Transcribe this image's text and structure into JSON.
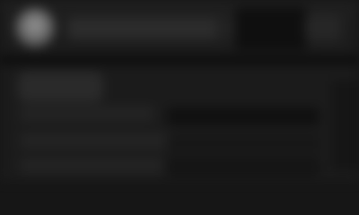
{
  "screen": {
    "accent_colors": {
      "background": "#1a1a1a",
      "avatar": "#8a8a8a",
      "dark_region": "#0f0f0f"
    }
  },
  "header": {
    "avatar_icon": "user-avatar-icon",
    "title": "",
    "action_icon": "menu-icon"
  },
  "form": {
    "rows": [
      {
        "label": "",
        "value": ""
      },
      {
        "label": "",
        "value": ""
      },
      {
        "label": "",
        "value": ""
      }
    ]
  }
}
